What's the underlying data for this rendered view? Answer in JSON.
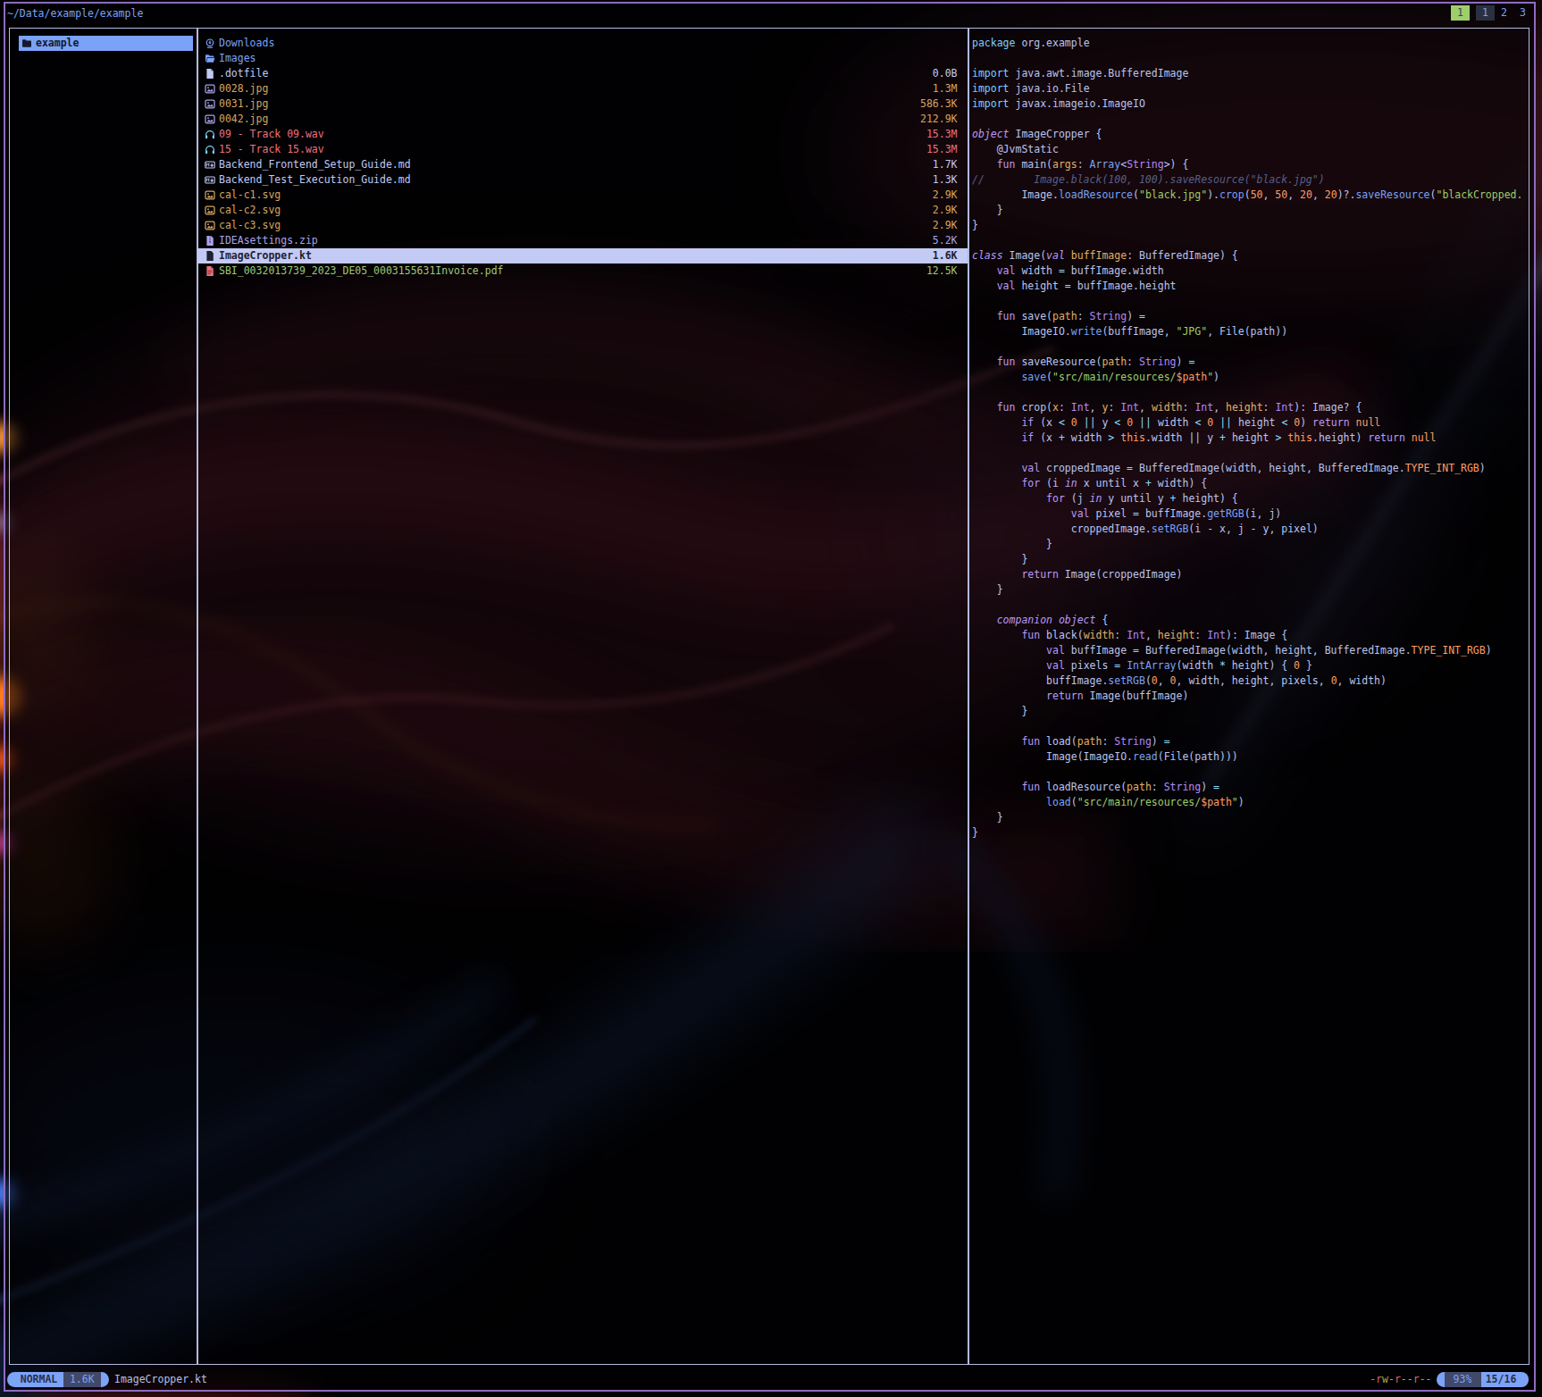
{
  "colors": {
    "accent_blue": "#7aa2f7",
    "cyan": "#7dcfff",
    "purple": "#bb9af7",
    "green": "#9ece6a",
    "yellow": "#e0af68",
    "orange": "#ff9e64",
    "red": "#f7768e",
    "foreground": "#c0caf5",
    "comment": "#565f89",
    "selection_bg": "#c3caf3",
    "pill_dark": "#414868",
    "pane_border": "#aab2d8",
    "window_border": "#8d6cc0",
    "tab_active_bg": "#9ece6a"
  },
  "header": {
    "path": "~/Data/example/example",
    "tabs": [
      {
        "label": "1",
        "style": "active-task"
      },
      {
        "label": "1",
        "style": "active"
      },
      {
        "label": "2",
        "style": ""
      },
      {
        "label": "3",
        "style": ""
      }
    ]
  },
  "parent_pane": {
    "items": [
      {
        "icon": "folder-icon",
        "label": "example",
        "hovered": true
      }
    ]
  },
  "file_list": {
    "items": [
      {
        "icon": "folder-download-icon",
        "icolor": "c-blue",
        "name": "Downloads",
        "color": "c-blue",
        "size": ""
      },
      {
        "icon": "folder-open-icon",
        "icolor": "c-blue",
        "name": "Images",
        "color": "c-blue",
        "size": ""
      },
      {
        "icon": "file-icon",
        "icolor": "c-fg",
        "name": ".dotfile",
        "color": "c-fg",
        "size": "0.0B"
      },
      {
        "icon": "image-icon",
        "icolor": "c-purple",
        "name": "0028.jpg",
        "color": "c-yellow",
        "size": "1.3M"
      },
      {
        "icon": "image-icon",
        "icolor": "c-purple",
        "name": "0031.jpg",
        "color": "c-yellow",
        "size": "586.3K"
      },
      {
        "icon": "image-icon",
        "icolor": "c-purple",
        "name": "0042.jpg",
        "color": "c-yellow",
        "size": "212.9K"
      },
      {
        "icon": "headphones-icon",
        "icolor": "c-cyan",
        "name": "09 - Track 09.wav",
        "color": "c-red",
        "size": "15.3M"
      },
      {
        "icon": "headphones-icon",
        "icolor": "c-cyan",
        "name": "15 - Track 15.wav",
        "color": "c-red",
        "size": "15.3M"
      },
      {
        "icon": "markdown-icon",
        "icolor": "c-fg",
        "name": "Backend_Frontend_Setup_Guide.md",
        "color": "c-fg",
        "size": "1.7K"
      },
      {
        "icon": "markdown-icon",
        "icolor": "c-fg",
        "name": "Backend_Test_Execution_Guide.md",
        "color": "c-fg",
        "size": "1.3K"
      },
      {
        "icon": "image-icon",
        "icolor": "c-yellow",
        "name": "cal-c1.svg",
        "color": "c-yellow",
        "size": "2.9K"
      },
      {
        "icon": "image-icon",
        "icolor": "c-yellow",
        "name": "cal-c2.svg",
        "color": "c-yellow",
        "size": "2.9K"
      },
      {
        "icon": "image-icon",
        "icolor": "c-yellow",
        "name": "cal-c3.svg",
        "color": "c-yellow",
        "size": "2.9K"
      },
      {
        "icon": "zip-icon",
        "icolor": "c-purple",
        "name": "IDEAsettings.zip",
        "color": "c-purple",
        "size": "5.2K"
      },
      {
        "icon": "file-icon",
        "icolor": "c-fg",
        "name": "ImageCropper.kt",
        "color": "c-fg",
        "size": "1.6K",
        "hovered": true
      },
      {
        "icon": "pdf-icon",
        "icolor": "c-red",
        "name": "SBI_0032013739_2023_DE05_0003155631Invoice.pdf",
        "color": "c-green",
        "size": "12.5K"
      }
    ]
  },
  "preview": {
    "lines": [
      [
        [
          "imp",
          "package"
        ],
        [
          "fg",
          " org.example"
        ]
      ],
      [],
      [
        [
          "imp",
          "import"
        ],
        [
          "fg",
          " java.awt.image.BufferedImage"
        ]
      ],
      [
        [
          "imp",
          "import"
        ],
        [
          "fg",
          " java.io.File"
        ]
      ],
      [
        [
          "imp",
          "import"
        ],
        [
          "fg",
          " javax.imageio.ImageIO"
        ]
      ],
      [],
      [
        [
          "kwi",
          "object"
        ],
        [
          "fg",
          " ImageCropper {"
        ]
      ],
      [
        [
          "fg",
          "    @JvmStatic"
        ]
      ],
      [
        [
          "kw",
          "    fun"
        ],
        [
          "fg",
          " main("
        ],
        [
          "param",
          "args"
        ],
        [
          "fg",
          ": "
        ],
        [
          "call",
          "Array"
        ],
        [
          "fg",
          "<"
        ],
        [
          "type",
          "String"
        ],
        [
          "fg",
          ">) {"
        ]
      ],
      [
        [
          "com",
          "//        Image.black(100, 100).saveResource(\"black.jpg\")"
        ]
      ],
      [
        [
          "fg",
          "        Image."
        ],
        [
          "call",
          "loadResource"
        ],
        [
          "fg",
          "("
        ],
        [
          "str",
          "\"black.jpg\""
        ],
        [
          "fg",
          ")."
        ],
        [
          "call",
          "crop"
        ],
        [
          "fg",
          "("
        ],
        [
          "num",
          "50"
        ],
        [
          "fg",
          ", "
        ],
        [
          "num",
          "50"
        ],
        [
          "fg",
          ", "
        ],
        [
          "num",
          "20"
        ],
        [
          "fg",
          ", "
        ],
        [
          "num",
          "20"
        ],
        [
          "fg",
          ")?."
        ],
        [
          "call",
          "saveResource"
        ],
        [
          "fg",
          "("
        ],
        [
          "str",
          "\"blackCropped."
        ]
      ],
      [
        [
          "fg",
          "    }"
        ]
      ],
      [
        [
          "fg",
          "}"
        ]
      ],
      [],
      [
        [
          "kwi",
          "class"
        ],
        [
          "fg",
          " Image("
        ],
        [
          "kwi",
          "val"
        ],
        [
          "fg",
          " "
        ],
        [
          "param",
          "buffImage"
        ],
        [
          "fg",
          ": BufferedImage) {"
        ]
      ],
      [
        [
          "kw",
          "    val"
        ],
        [
          "fg",
          " width "
        ],
        [
          "op",
          "="
        ],
        [
          "fg",
          " buffImage.width"
        ]
      ],
      [
        [
          "kw",
          "    val"
        ],
        [
          "fg",
          " height "
        ],
        [
          "op",
          "="
        ],
        [
          "fg",
          " buffImage.height"
        ]
      ],
      [],
      [
        [
          "kw",
          "    fun"
        ],
        [
          "fg",
          " save("
        ],
        [
          "param",
          "path"
        ],
        [
          "fg",
          ": "
        ],
        [
          "type",
          "String"
        ],
        [
          "fg",
          ") "
        ],
        [
          "op",
          "="
        ]
      ],
      [
        [
          "fg",
          "        ImageIO."
        ],
        [
          "call",
          "write"
        ],
        [
          "fg",
          "(buffImage, "
        ],
        [
          "str",
          "\"JPG\""
        ],
        [
          "fg",
          ", File(path))"
        ]
      ],
      [],
      [
        [
          "kw",
          "    fun"
        ],
        [
          "fg",
          " saveResource("
        ],
        [
          "param",
          "path"
        ],
        [
          "fg",
          ": "
        ],
        [
          "type",
          "String"
        ],
        [
          "fg",
          ") "
        ],
        [
          "op",
          "="
        ]
      ],
      [
        [
          "fg",
          "        "
        ],
        [
          "call",
          "save"
        ],
        [
          "fg",
          "("
        ],
        [
          "str",
          "\"src/main/resources/"
        ],
        [
          "num",
          "$path"
        ],
        [
          "str",
          "\""
        ],
        [
          "fg",
          ")"
        ]
      ],
      [],
      [
        [
          "kw",
          "    fun"
        ],
        [
          "fg",
          " crop("
        ],
        [
          "param",
          "x"
        ],
        [
          "fg",
          ": "
        ],
        [
          "type",
          "Int"
        ],
        [
          "fg",
          ", "
        ],
        [
          "param",
          "y"
        ],
        [
          "fg",
          ": "
        ],
        [
          "type",
          "Int"
        ],
        [
          "fg",
          ", "
        ],
        [
          "param",
          "width"
        ],
        [
          "fg",
          ": "
        ],
        [
          "type",
          "Int"
        ],
        [
          "fg",
          ", "
        ],
        [
          "param",
          "height"
        ],
        [
          "fg",
          ": "
        ],
        [
          "type",
          "Int"
        ],
        [
          "fg",
          "): Image? {"
        ]
      ],
      [
        [
          "kw",
          "        if"
        ],
        [
          "fg",
          " (x "
        ],
        [
          "op",
          "<"
        ],
        [
          "fg",
          " "
        ],
        [
          "num",
          "0"
        ],
        [
          "fg",
          " "
        ],
        [
          "op",
          "||"
        ],
        [
          "fg",
          " y "
        ],
        [
          "op",
          "<"
        ],
        [
          "fg",
          " "
        ],
        [
          "num",
          "0"
        ],
        [
          "fg",
          " "
        ],
        [
          "op",
          "||"
        ],
        [
          "fg",
          " width "
        ],
        [
          "op",
          "<"
        ],
        [
          "fg",
          " "
        ],
        [
          "num",
          "0"
        ],
        [
          "fg",
          " "
        ],
        [
          "op",
          "||"
        ],
        [
          "fg",
          " height "
        ],
        [
          "op",
          "<"
        ],
        [
          "fg",
          " "
        ],
        [
          "num",
          "0"
        ],
        [
          "fg",
          ") "
        ],
        [
          "kw",
          "return"
        ],
        [
          "fg",
          " "
        ],
        [
          "num",
          "null"
        ]
      ],
      [
        [
          "kw",
          "        if"
        ],
        [
          "fg",
          " (x "
        ],
        [
          "op",
          "+"
        ],
        [
          "fg",
          " width "
        ],
        [
          "op",
          ">"
        ],
        [
          "fg",
          " "
        ],
        [
          "num",
          "this"
        ],
        [
          "fg",
          ".width "
        ],
        [
          "op",
          "||"
        ],
        [
          "fg",
          " y "
        ],
        [
          "op",
          "+"
        ],
        [
          "fg",
          " height "
        ],
        [
          "op",
          ">"
        ],
        [
          "fg",
          " "
        ],
        [
          "num",
          "this"
        ],
        [
          "fg",
          ".height) "
        ],
        [
          "kw",
          "return"
        ],
        [
          "fg",
          " "
        ],
        [
          "num",
          "null"
        ]
      ],
      [],
      [
        [
          "kw",
          "        val"
        ],
        [
          "fg",
          " croppedImage "
        ],
        [
          "op",
          "="
        ],
        [
          "fg",
          " BufferedImage(width, height, BufferedImage."
        ],
        [
          "num",
          "TYPE_INT_RGB"
        ],
        [
          "fg",
          ")"
        ]
      ],
      [
        [
          "kw",
          "        for"
        ],
        [
          "fg",
          " (i "
        ],
        [
          "kwi",
          "in"
        ],
        [
          "fg",
          " x until x "
        ],
        [
          "op",
          "+"
        ],
        [
          "fg",
          " width) {"
        ]
      ],
      [
        [
          "kw",
          "            for"
        ],
        [
          "fg",
          " (j "
        ],
        [
          "kwi",
          "in"
        ],
        [
          "fg",
          " y until y "
        ],
        [
          "op",
          "+"
        ],
        [
          "fg",
          " height) {"
        ]
      ],
      [
        [
          "kw",
          "                val"
        ],
        [
          "fg",
          " pixel "
        ],
        [
          "op",
          "="
        ],
        [
          "fg",
          " buffImage."
        ],
        [
          "call",
          "getRGB"
        ],
        [
          "fg",
          "(i, j)"
        ]
      ],
      [
        [
          "fg",
          "                croppedImage."
        ],
        [
          "call",
          "setRGB"
        ],
        [
          "fg",
          "(i "
        ],
        [
          "op",
          "-"
        ],
        [
          "fg",
          " x, j "
        ],
        [
          "op",
          "-"
        ],
        [
          "fg",
          " y, pixel)"
        ]
      ],
      [
        [
          "fg",
          "            }"
        ]
      ],
      [
        [
          "fg",
          "        }"
        ]
      ],
      [
        [
          "kw",
          "        return"
        ],
        [
          "fg",
          " Image(croppedImage)"
        ]
      ],
      [
        [
          "fg",
          "    }"
        ]
      ],
      [],
      [
        [
          "kwi",
          "    companion object"
        ],
        [
          "fg",
          " {"
        ]
      ],
      [
        [
          "kw",
          "        fun"
        ],
        [
          "fg",
          " black("
        ],
        [
          "param",
          "width"
        ],
        [
          "fg",
          ": "
        ],
        [
          "type",
          "Int"
        ],
        [
          "fg",
          ", "
        ],
        [
          "param",
          "height"
        ],
        [
          "fg",
          ": "
        ],
        [
          "type",
          "Int"
        ],
        [
          "fg",
          "): Image {"
        ]
      ],
      [
        [
          "kw",
          "            val"
        ],
        [
          "fg",
          " buffImage "
        ],
        [
          "op",
          "="
        ],
        [
          "fg",
          " BufferedImage(width, height, BufferedImage."
        ],
        [
          "num",
          "TYPE_INT_RGB"
        ],
        [
          "fg",
          ")"
        ]
      ],
      [
        [
          "kw",
          "            val"
        ],
        [
          "fg",
          " pixels "
        ],
        [
          "op",
          "="
        ],
        [
          "fg",
          " "
        ],
        [
          "call",
          "IntArray"
        ],
        [
          "fg",
          "(width "
        ],
        [
          "op",
          "*"
        ],
        [
          "fg",
          " height) { "
        ],
        [
          "num",
          "0"
        ],
        [
          "fg",
          " }"
        ]
      ],
      [
        [
          "fg",
          "            buffImage."
        ],
        [
          "call",
          "setRGB"
        ],
        [
          "fg",
          "("
        ],
        [
          "num",
          "0"
        ],
        [
          "fg",
          ", "
        ],
        [
          "num",
          "0"
        ],
        [
          "fg",
          ", width, height, pixels, "
        ],
        [
          "num",
          "0"
        ],
        [
          "fg",
          ", width)"
        ]
      ],
      [
        [
          "kw",
          "            return"
        ],
        [
          "fg",
          " Image(buffImage)"
        ]
      ],
      [
        [
          "fg",
          "        }"
        ]
      ],
      [],
      [
        [
          "kw",
          "        fun"
        ],
        [
          "fg",
          " load("
        ],
        [
          "param",
          "path"
        ],
        [
          "fg",
          ": "
        ],
        [
          "type",
          "String"
        ],
        [
          "fg",
          ") "
        ],
        [
          "op",
          "="
        ]
      ],
      [
        [
          "fg",
          "            Image(ImageIO."
        ],
        [
          "call",
          "read"
        ],
        [
          "fg",
          "(File(path)))"
        ]
      ],
      [],
      [
        [
          "kw",
          "        fun"
        ],
        [
          "fg",
          " loadResource("
        ],
        [
          "param",
          "path"
        ],
        [
          "fg",
          ": "
        ],
        [
          "type",
          "String"
        ],
        [
          "fg",
          ") "
        ],
        [
          "op",
          "="
        ]
      ],
      [
        [
          "fg",
          "            "
        ],
        [
          "call",
          "load"
        ],
        [
          "fg",
          "("
        ],
        [
          "str",
          "\"src/main/resources/"
        ],
        [
          "num",
          "$path"
        ],
        [
          "str",
          "\""
        ],
        [
          "fg",
          ")"
        ]
      ],
      [
        [
          "fg",
          "    }"
        ]
      ],
      [
        [
          "fg",
          "}"
        ]
      ]
    ]
  },
  "status_bar": {
    "mode": "NORMAL",
    "file_size": "1.6K",
    "file_name": "ImageCropper.kt",
    "permissions": "-rw-r--r--",
    "percent": "93%",
    "position": "15/16"
  }
}
